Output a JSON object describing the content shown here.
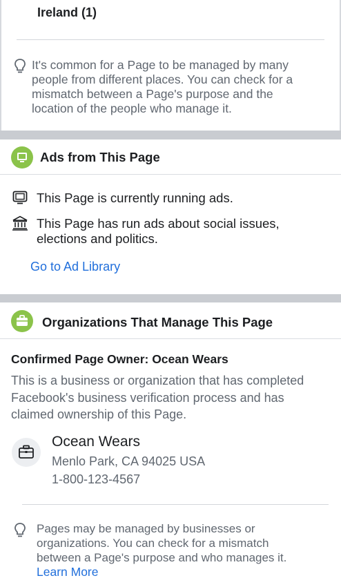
{
  "location": {
    "country_label": "Ireland (1)",
    "tip_lines": [
      "It's common for a Page to be managed by many",
      "people from different places. You can check for a",
      "mismatch between a Page's purpose and the",
      "location of the people who manage it."
    ]
  },
  "ads": {
    "title": "Ads from This Page",
    "running_text": "This Page is currently running ads.",
    "political_lines": [
      "This Page has run ads about social issues,",
      "elections and politics."
    ],
    "link_label": "Go to Ad Library"
  },
  "orgs": {
    "title": "Organizations That Manage This Page",
    "confirm_title": "Confirmed Page Owner: Ocean Wears",
    "confirm_desc": "This is a business or organization that has completed Facebook's business verification process and has claimed ownership of this Page.",
    "org_name": "Ocean Wears",
    "org_address": "Menlo Park, CA 94025 USA",
    "org_phone": "1-800-123-4567",
    "tip_lines": [
      "Pages may be managed by businesses or",
      "organizations. You can check for a mismatch",
      "between a Page's purpose and who manages it."
    ],
    "learn_more": "Learn More"
  },
  "colors": {
    "accent": "#216fdb",
    "badge": "#8bc34a",
    "muted": "#606770"
  },
  "icons": [
    "lightbulb-icon",
    "monitor-icon",
    "ad-icon",
    "bank-icon",
    "briefcase-icon"
  ]
}
